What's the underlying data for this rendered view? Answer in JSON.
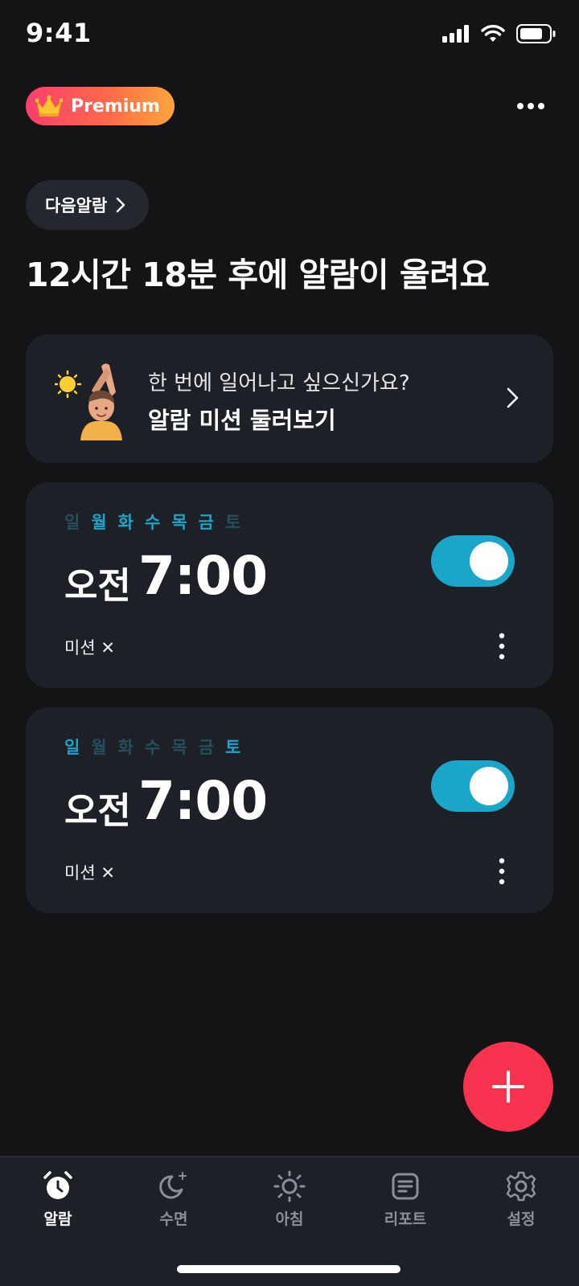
{
  "status_bar": {
    "time": "9:41"
  },
  "header": {
    "premium_label": "Premium",
    "more_icon": "more-horizontal-icon"
  },
  "next_alarm": {
    "chip_label": "다음알람",
    "headline": "12시간 18분 후에 알람이 울려요"
  },
  "mission_banner": {
    "subtitle": "한 번에 일어나고 싶으신가요?",
    "title": "알람 미션 둘러보기"
  },
  "alarms": [
    {
      "days": [
        {
          "label": "일",
          "active": false
        },
        {
          "label": "월",
          "active": true
        },
        {
          "label": "화",
          "active": true
        },
        {
          "label": "수",
          "active": true
        },
        {
          "label": "목",
          "active": true
        },
        {
          "label": "금",
          "active": true
        },
        {
          "label": "토",
          "active": false
        }
      ],
      "ampm": "오전",
      "time": "7:00",
      "enabled": true,
      "mission_label": "미션 ✕"
    },
    {
      "days": [
        {
          "label": "일",
          "active": true
        },
        {
          "label": "월",
          "active": false
        },
        {
          "label": "화",
          "active": false
        },
        {
          "label": "수",
          "active": false
        },
        {
          "label": "목",
          "active": false
        },
        {
          "label": "금",
          "active": false
        },
        {
          "label": "토",
          "active": true
        }
      ],
      "ampm": "오전",
      "time": "7:00",
      "enabled": true,
      "mission_label": "미션 ✕"
    }
  ],
  "tabs": [
    {
      "label": "알람",
      "icon": "alarm-clock-icon",
      "active": true
    },
    {
      "label": "수면",
      "icon": "moon-icon",
      "active": false
    },
    {
      "label": "아침",
      "icon": "sun-icon",
      "active": false
    },
    {
      "label": "리포트",
      "icon": "report-icon",
      "active": false
    },
    {
      "label": "설정",
      "icon": "gear-icon",
      "active": false
    }
  ],
  "colors": {
    "accent": "#1aa6c9",
    "fab": "#f7334f",
    "background": "#141416",
    "card": "#1e2027"
  }
}
